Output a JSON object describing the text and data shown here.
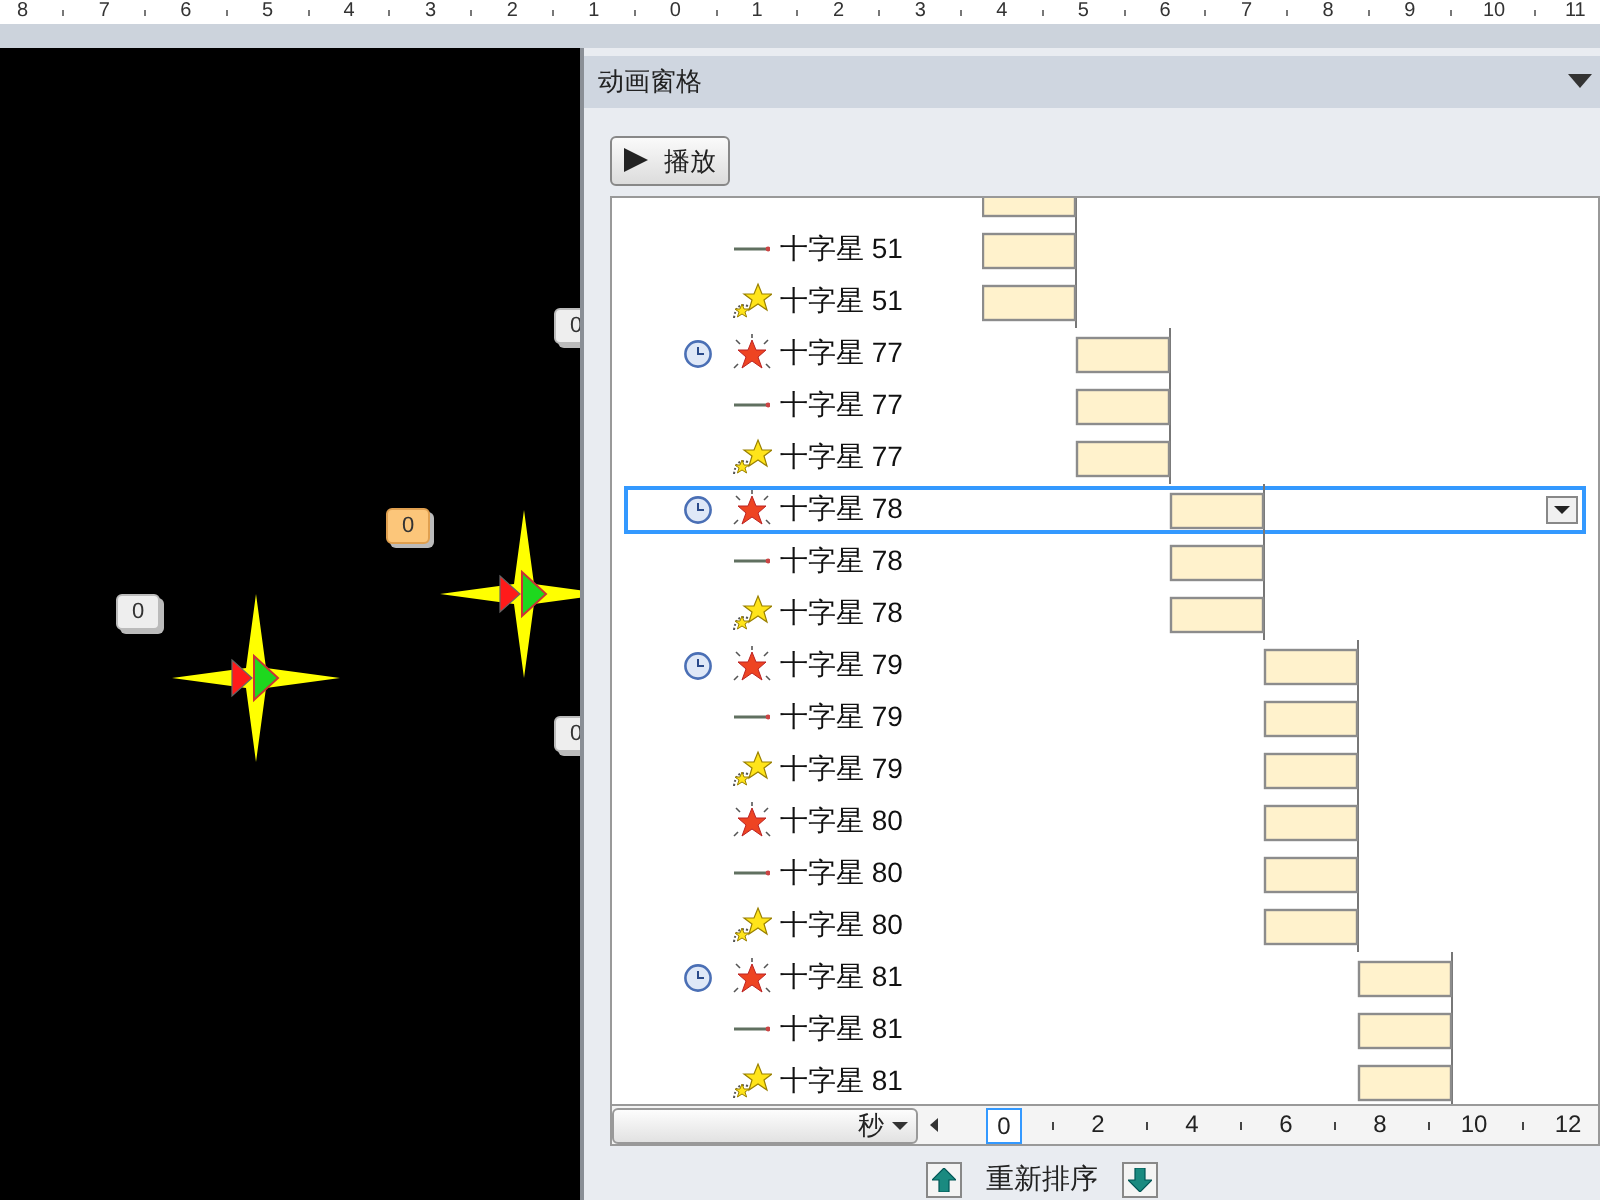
{
  "ruler": {
    "labels": [
      "8",
      "7",
      "6",
      "5",
      "4",
      "3",
      "2",
      "1",
      "0",
      "1",
      "2",
      "3",
      "4",
      "5",
      "6",
      "7",
      "8",
      "9",
      "10",
      "11"
    ]
  },
  "slide": {
    "badges": [
      {
        "text": "0",
        "highlighted": false
      },
      {
        "text": "0",
        "highlighted": true
      },
      {
        "text": "0",
        "highlighted": false
      },
      {
        "text": "0",
        "highlighted": false
      }
    ]
  },
  "pane": {
    "title": "动画窗格",
    "play_button": "播放",
    "rows": [
      {
        "clock": false,
        "selected": false
      },
      {
        "label": "十字星 51",
        "kind": "path",
        "clock": false,
        "selected": false
      },
      {
        "label": "十字星 51",
        "kind": "stars",
        "clock": false,
        "selected": false
      },
      {
        "label": "十字星 77",
        "kind": "starburst",
        "clock": true,
        "selected": false
      },
      {
        "label": "十字星 77",
        "kind": "path",
        "clock": false,
        "selected": false
      },
      {
        "label": "十字星 77",
        "kind": "stars",
        "clock": false,
        "selected": false
      },
      {
        "label": "十字星 78",
        "kind": "starburst",
        "clock": true,
        "selected": true
      },
      {
        "label": "十字星 78",
        "kind": "path",
        "clock": false,
        "selected": false
      },
      {
        "label": "十字星 78",
        "kind": "stars",
        "clock": false,
        "selected": false
      },
      {
        "label": "十字星 79",
        "kind": "starburst",
        "clock": true,
        "selected": false
      },
      {
        "label": "十字星 79",
        "kind": "path",
        "clock": false,
        "selected": false
      },
      {
        "label": "十字星 79",
        "kind": "stars",
        "clock": false,
        "selected": false
      },
      {
        "label": "十字星 80",
        "kind": "starburst",
        "clock": false,
        "selected": false
      },
      {
        "label": "十字星 80",
        "kind": "path",
        "clock": false,
        "selected": false
      },
      {
        "label": "十字星 80",
        "kind": "stars",
        "clock": false,
        "selected": false
      },
      {
        "label": "十字星 81",
        "kind": "starburst",
        "clock": true,
        "selected": false
      },
      {
        "label": "十字星 81",
        "kind": "path",
        "clock": false,
        "selected": false
      },
      {
        "label": "十字星 81",
        "kind": "stars",
        "clock": false,
        "selected": false
      }
    ],
    "timeline": {
      "unit": "秒",
      "ticks": [
        "0",
        "2",
        "4",
        "6",
        "8",
        "10",
        "12"
      ]
    },
    "reorder": {
      "label": "重新排序"
    }
  }
}
